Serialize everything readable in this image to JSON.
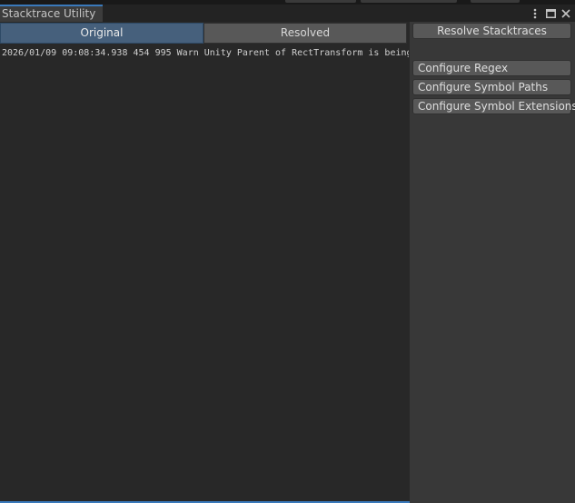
{
  "window": {
    "tab_title": "Stacktrace Utility",
    "icons": {
      "menu": "more-vertical-icon",
      "maximize": "maximize-icon",
      "close": "close-icon"
    }
  },
  "toggles": {
    "original_label": "Original",
    "resolved_label": "Resolved",
    "selected": "Original"
  },
  "log": {
    "lines": [
      "2026/01/09 09:08:34.938 454 995 Warn Unity Parent of RectTransform is being"
    ]
  },
  "actions": {
    "resolve_label": "Resolve Stacktraces",
    "configure_regex_label": "Configure Regex",
    "configure_symbol_paths_label": "Configure Symbol Paths",
    "configure_symbol_extensions_label": "Configure Symbol Extensions"
  },
  "colors": {
    "accent": "#3a79bb",
    "active_toggle": "#46607c",
    "panel_bg": "#383838",
    "log_bg": "#282828"
  }
}
